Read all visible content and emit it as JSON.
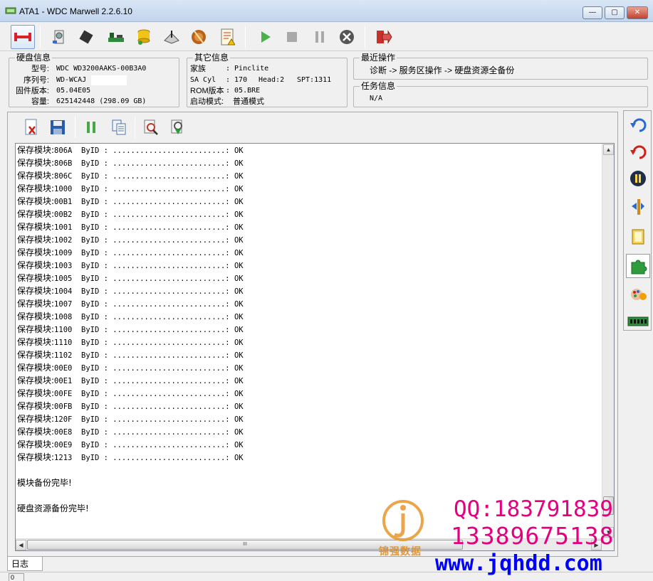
{
  "window": {
    "title": "ATA1 - WDC Marwell 2.2.6.10",
    "minimize_glyph": "—",
    "maximize_glyph": "▢",
    "close_glyph": "✕"
  },
  "toolbar": {
    "icons": [
      "connect-icon",
      "hdd-icon",
      "chip-icon",
      "board-icon",
      "db-icon",
      "write-icon",
      "disc-icon",
      "report-icon",
      "play-icon",
      "stop-icon",
      "pause-icon",
      "cancel-icon",
      "exit-icon"
    ]
  },
  "disk_info": {
    "legend": "硬盘信息",
    "model_label": "型号:",
    "model": "WDC WD3200AAKS-00B3A0",
    "serial_label": "序列号:",
    "serial": "WD-WCAJ",
    "firmware_label": "固件版本:",
    "firmware": "05.04E05",
    "capacity_label": "容量:",
    "capacity": "625142448 (298.09 GB)"
  },
  "other_info": {
    "legend": "其它信息",
    "family_label": "家族",
    "family": ": Pinclite",
    "sacyl_label": "SA Cyl",
    "sacyl": ": 170",
    "head": "Head:2",
    "spt": "SPT:1311",
    "rom_label": "ROM版本",
    "rom": ": 05.BRE",
    "boot_label": "启动模式:",
    "boot": "普通模式"
  },
  "recent_ops": {
    "legend": "最近操作",
    "path": "诊断 -> 服务区操作 -> 硬盘资源全备份"
  },
  "task_info": {
    "legend": "任务信息",
    "value": "N/A"
  },
  "log": {
    "prefix": "保存模块:",
    "method": "ByID",
    "dots": ": .........................: ",
    "status": "OK",
    "modules": [
      "806A",
      "806B",
      "806C",
      "1000",
      "00B1",
      "00B2",
      "1001",
      "1002",
      "1009",
      "1003",
      "1005",
      "1004",
      "1007",
      "1008",
      "1100",
      "1110",
      "1102",
      "00E0",
      "00E1",
      "00FE",
      "00FB",
      "120F",
      "00E8",
      "00E9",
      "1213"
    ],
    "module_done": "模块备份完毕!",
    "resource_done": "硬盘资源备份完毕!"
  },
  "scroll": {
    "hthumb_glyph": "III",
    "up": "▲",
    "down": "▼",
    "left": "◀",
    "right": "▶"
  },
  "tabs": {
    "log_tab": "日志"
  },
  "status": {
    "cell": "0"
  },
  "watermark": {
    "brand": "锦强数据",
    "qq": "QQ:183791839",
    "phone": "13389675138",
    "site": "www.jqhdd.com"
  },
  "colors": {
    "accent_magenta": "#e4007f",
    "site_blue": "#0000ff",
    "logo_orange": "#e08a1e"
  }
}
